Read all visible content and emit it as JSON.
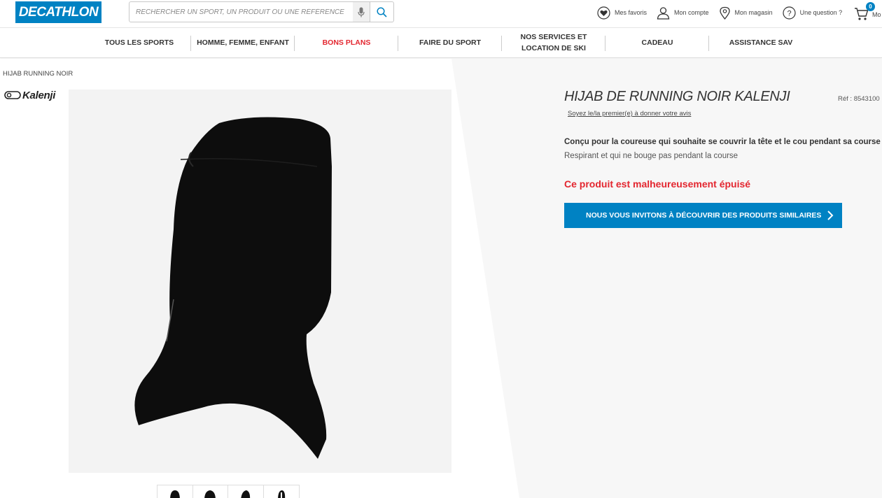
{
  "header": {
    "logo": "DECATHLON",
    "search_placeholder": "RECHERCHER UN SPORT, UN PRODUIT OU UNE RÉFÉRENCE",
    "links": [
      {
        "label": "Mes favoris",
        "icon": "heart-icon"
      },
      {
        "label": "Mon compte",
        "icon": "user-icon"
      },
      {
        "label": "Mon magasin",
        "icon": "location-pin-icon"
      },
      {
        "label": "Une question ?",
        "icon": "help-circle-icon"
      }
    ],
    "cart_count": "0",
    "cart_label": "Mo"
  },
  "nav": {
    "items": [
      {
        "label": "TOUS LES SPORTS"
      },
      {
        "label": "HOMME, FEMME, ENFANT"
      },
      {
        "label": "BONS PLANS"
      },
      {
        "label": "FAIRE DU SPORT"
      },
      {
        "label": "NOS SERVICES ET LOCATION DE SKI"
      },
      {
        "label": "CADEAU"
      },
      {
        "label": "ASSISTANCE SAV"
      }
    ]
  },
  "breadcrumb": "HIJAB RUNNING NOIR",
  "brand": "Kalenji",
  "product": {
    "title": "HIJAB DE RUNNING NOIR KALENJI",
    "ref": "Réf : 8543100",
    "review_link": "Soyez le/la premier(e) à donner votre avis",
    "description_main": "Conçu pour la coureuse qui souhaite se couvrir la tête et le cou pendant sa course",
    "description_sub": "Respirant et qui ne bouge pas pendant la course",
    "status": "Ce produit est malheureusement épuisé",
    "cta": "NOUS VOUS INVITONS À DÉCOUVRIR DES PRODUITS SIMILAIRES"
  },
  "colors": {
    "brand_blue": "#0082c3",
    "alert_red": "#e3262f"
  }
}
